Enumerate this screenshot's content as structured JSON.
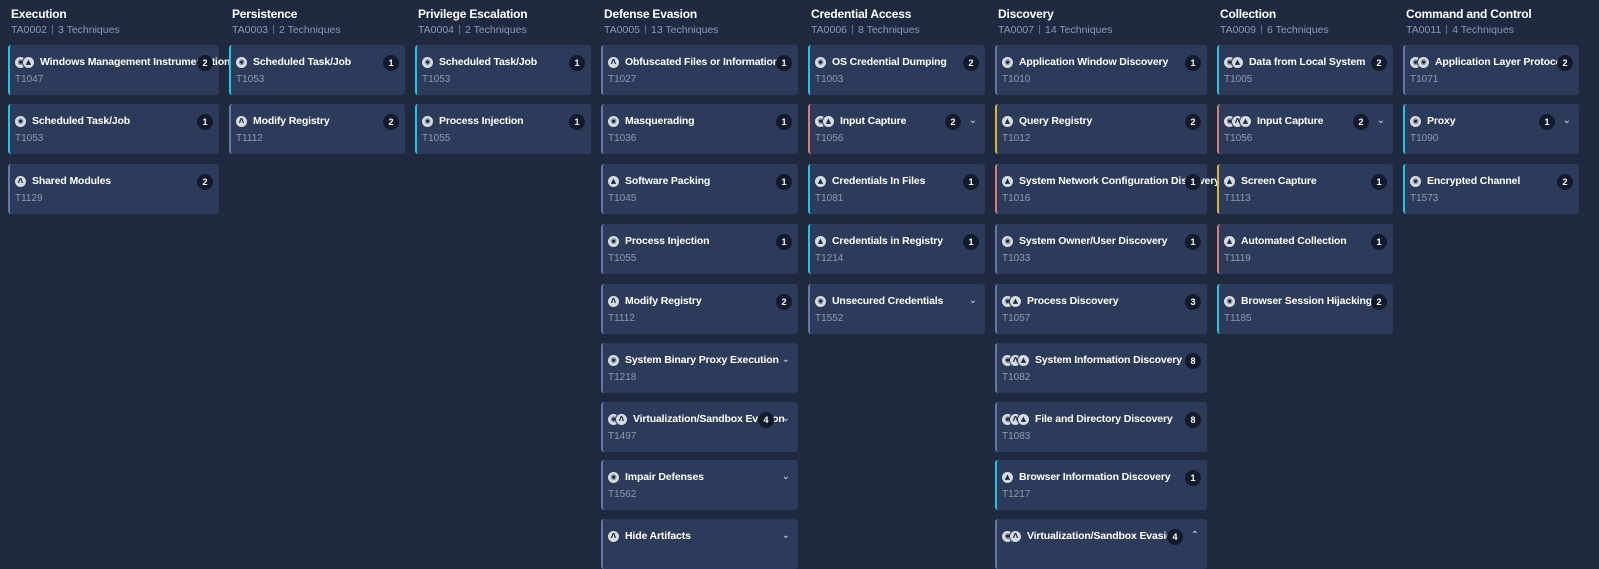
{
  "columns": [
    {
      "key": "execution",
      "title": "Execution",
      "id": "TA0002",
      "count": "3 Techniques",
      "cards": [
        {
          "key": "windows-management-instrumentation",
          "name": "Windows Management Instrumentation",
          "tid": "T1047",
          "badge": "2",
          "accent": "cyan",
          "icons": [
            "windows-icon",
            "linux-icon"
          ]
        },
        {
          "key": "scheduled-task-job",
          "name": "Scheduled Task/Job",
          "tid": "T1053",
          "badge": "1",
          "accent": "cyan",
          "icons": [
            "windows-icon"
          ]
        },
        {
          "key": "shared-modules",
          "name": "Shared Modules",
          "tid": "T1129",
          "badge": "2",
          "accent": "blue",
          "icons": [
            "macos-icon"
          ]
        }
      ]
    },
    {
      "key": "persistence",
      "title": "Persistence",
      "id": "TA0003",
      "count": "2 Techniques",
      "cards": [
        {
          "key": "scheduled-task-job",
          "name": "Scheduled Task/Job",
          "tid": "T1053",
          "badge": "1",
          "accent": "cyan",
          "icons": [
            "windows-icon"
          ]
        },
        {
          "key": "modify-registry",
          "name": "Modify Registry",
          "tid": "T1112",
          "badge": "2",
          "accent": "blue",
          "icons": [
            "macos-icon"
          ]
        }
      ]
    },
    {
      "key": "privilege-escalation",
      "title": "Privilege Escalation",
      "id": "TA0004",
      "count": "2 Techniques",
      "cards": [
        {
          "key": "scheduled-task-job",
          "name": "Scheduled Task/Job",
          "tid": "T1053",
          "badge": "1",
          "accent": "cyan",
          "icons": [
            "windows-icon"
          ]
        },
        {
          "key": "process-injection",
          "name": "Process Injection",
          "tid": "T1055",
          "badge": "1",
          "accent": "cyan",
          "icons": [
            "windows-icon"
          ]
        }
      ]
    },
    {
      "key": "defense-evasion",
      "title": "Defense Evasion",
      "id": "TA0005",
      "count": "13 Techniques",
      "cards": [
        {
          "key": "obfuscated-files-or-information",
          "name": "Obfuscated Files or Information",
          "tid": "T1027",
          "badge": "1",
          "accent": "blue",
          "icons": [
            "macos-icon"
          ]
        },
        {
          "key": "masquerading",
          "name": "Masquerading",
          "tid": "T1036",
          "badge": "1",
          "accent": "blue",
          "icons": [
            "windows-icon"
          ]
        },
        {
          "key": "software-packing",
          "name": "Software Packing",
          "tid": "T1045",
          "badge": "1",
          "accent": "blue",
          "icons": [
            "linux-icon"
          ]
        },
        {
          "key": "process-injection",
          "name": "Process Injection",
          "tid": "T1055",
          "badge": "1",
          "accent": "blue",
          "icons": [
            "windows-icon"
          ]
        },
        {
          "key": "modify-registry",
          "name": "Modify Registry",
          "tid": "T1112",
          "badge": "2",
          "accent": "blue",
          "icons": [
            "macos-icon"
          ]
        },
        {
          "key": "system-binary-proxy-execution",
          "name": "System Binary Proxy Execution",
          "tid": "T1218",
          "badge": "",
          "chevron": "⌄",
          "accent": "blue",
          "icons": [
            "windows-icon"
          ]
        },
        {
          "key": "virtualization-sandbox-evasion",
          "name": "Virtualization/Sandbox Evasion",
          "tid": "T1497",
          "badge": "4",
          "chevron": "⌄",
          "accent": "blue",
          "icons": [
            "windows-icon",
            "macos-icon"
          ]
        },
        {
          "key": "impair-defenses",
          "name": "Impair Defenses",
          "tid": "T1562",
          "badge": "",
          "chevron": "⌄",
          "accent": "blue",
          "icons": [
            "windows-icon"
          ]
        },
        {
          "key": "hide-artifacts",
          "name": "Hide Artifacts",
          "tid": "",
          "badge": "",
          "chevron": "⌄",
          "accent": "blue",
          "icons": [
            "macos-icon"
          ]
        }
      ]
    },
    {
      "key": "credential-access",
      "title": "Credential Access",
      "id": "TA0006",
      "count": "8 Techniques",
      "cards": [
        {
          "key": "os-credential-dumping",
          "name": "OS Credential Dumping",
          "tid": "T1003",
          "badge": "2",
          "accent": "cyan",
          "icons": [
            "windows-icon"
          ]
        },
        {
          "key": "input-capture",
          "name": "Input Capture",
          "tid": "T1056",
          "badge": "2",
          "chevron": "⌄",
          "accent": "red",
          "icons": [
            "windows-icon",
            "linux-icon"
          ]
        },
        {
          "key": "credentials-in-files",
          "name": "Credentials In Files",
          "tid": "T1081",
          "badge": "1",
          "accent": "cyan",
          "icons": [
            "linux-icon"
          ]
        },
        {
          "key": "credentials-in-registry",
          "name": "Credentials in Registry",
          "tid": "T1214",
          "badge": "1",
          "accent": "cyan",
          "icons": [
            "linux-icon"
          ]
        },
        {
          "key": "unsecured-credentials",
          "name": "Unsecured Credentials",
          "tid": "T1552",
          "badge": "",
          "chevron": "⌄",
          "accent": "blue",
          "icons": [
            "windows-icon"
          ]
        }
      ]
    },
    {
      "key": "discovery",
      "title": "Discovery",
      "id": "TA0007",
      "count": "14 Techniques",
      "cards": [
        {
          "key": "application-window-discovery",
          "name": "Application Window Discovery",
          "tid": "T1010",
          "badge": "1",
          "accent": "blue",
          "icons": [
            "windows-icon"
          ]
        },
        {
          "key": "query-registry",
          "name": "Query Registry",
          "tid": "T1012",
          "badge": "2",
          "accent": "yellow",
          "icons": [
            "linux-icon"
          ]
        },
        {
          "key": "system-network-configuration-discovery",
          "name": "System Network Configuration Discovery",
          "tid": "T1016",
          "badge": "1",
          "accent": "red",
          "icons": [
            "linux-icon"
          ]
        },
        {
          "key": "system-owner-user-discovery",
          "name": "System Owner/User Discovery",
          "tid": "T1033",
          "badge": "1",
          "accent": "blue",
          "icons": [
            "windows-icon"
          ]
        },
        {
          "key": "process-discovery",
          "name": "Process Discovery",
          "tid": "T1057",
          "badge": "3",
          "accent": "blue",
          "icons": [
            "windows-icon",
            "linux-icon"
          ]
        },
        {
          "key": "system-information-discovery",
          "name": "System Information Discovery",
          "tid": "T1082",
          "badge": "8",
          "accent": "blue",
          "icons": [
            "windows-icon",
            "macos-icon",
            "linux-icon"
          ]
        },
        {
          "key": "file-and-directory-discovery",
          "name": "File and Directory Discovery",
          "tid": "T1083",
          "badge": "8",
          "accent": "blue",
          "icons": [
            "windows-icon",
            "macos-icon",
            "linux-icon"
          ]
        },
        {
          "key": "browser-information-discovery",
          "name": "Browser Information Discovery",
          "tid": "T1217",
          "badge": "1",
          "accent": "cyan",
          "icons": [
            "linux-icon"
          ]
        },
        {
          "key": "virtualization-sandbox-evasion",
          "name": "Virtualization/Sandbox Evasion",
          "tid": "",
          "badge": "4",
          "chevron": "⌃",
          "accent": "blue",
          "icons": [
            "windows-icon",
            "macos-icon"
          ]
        }
      ]
    },
    {
      "key": "collection",
      "title": "Collection",
      "id": "TA0009",
      "count": "6 Techniques",
      "cards": [
        {
          "key": "data-from-local-system",
          "name": "Data from Local System",
          "tid": "T1005",
          "badge": "2",
          "accent": "cyan",
          "icons": [
            "windows-icon",
            "linux-icon"
          ]
        },
        {
          "key": "input-capture",
          "name": "Input Capture",
          "tid": "T1056",
          "badge": "2",
          "chevron": "⌄",
          "accent": "red",
          "icons": [
            "windows-icon",
            "macos-icon",
            "linux-icon"
          ]
        },
        {
          "key": "screen-capture",
          "name": "Screen Capture",
          "tid": "T1113",
          "badge": "1",
          "accent": "yellow",
          "icons": [
            "linux-icon"
          ]
        },
        {
          "key": "automated-collection",
          "name": "Automated Collection",
          "tid": "T1119",
          "badge": "1",
          "accent": "red",
          "icons": [
            "linux-icon"
          ]
        },
        {
          "key": "browser-session-hijacking",
          "name": "Browser Session Hijacking",
          "tid": "T1185",
          "badge": "2",
          "accent": "cyan",
          "icons": [
            "windows-icon"
          ]
        }
      ]
    },
    {
      "key": "command-and-control",
      "title": "Command and Control",
      "id": "TA0011",
      "count": "4 Techniques",
      "cards": [
        {
          "key": "application-layer-protocol",
          "name": "Application Layer Protocol",
          "tid": "T1071",
          "badge": "2",
          "accent": "blue",
          "icons": [
            "windows-icon",
            "windows-icon"
          ]
        },
        {
          "key": "proxy",
          "name": "Proxy",
          "tid": "T1090",
          "badge": "1",
          "chevron": "⌄",
          "accent": "cyan",
          "icons": [
            "windows-icon"
          ]
        },
        {
          "key": "encrypted-channel",
          "name": "Encrypted Channel",
          "tid": "T1573",
          "badge": "2",
          "accent": "cyan",
          "icons": [
            "windows-icon"
          ]
        }
      ]
    }
  ]
}
